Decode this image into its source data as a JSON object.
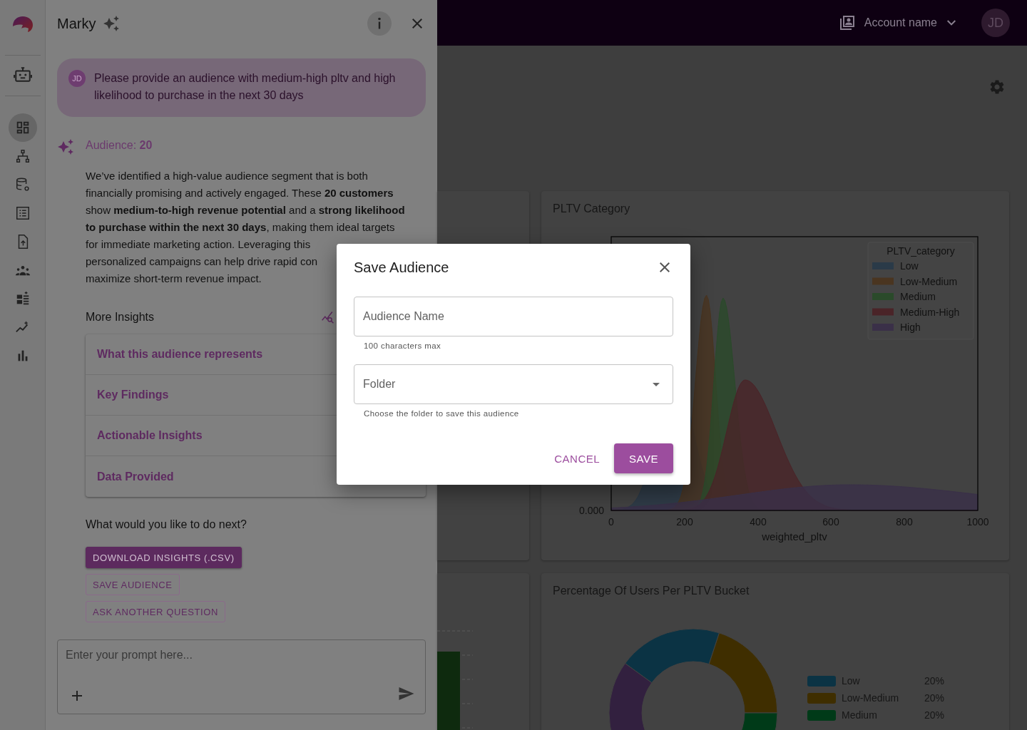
{
  "nav_rail": {
    "items": [
      {
        "selected": true
      },
      {
        "selected": false
      },
      {
        "selected": false
      },
      {
        "selected": false
      },
      {
        "selected": false
      },
      {
        "selected": false
      },
      {
        "selected": false
      },
      {
        "selected": false
      },
      {
        "selected": false
      }
    ]
  },
  "chat": {
    "title": "Marky",
    "user_message": {
      "avatar": "JD",
      "text": "Please provide an audience with medium-high pltv and high likelihood to purchase in the next 30 days"
    },
    "response": {
      "heading": "Audience: **20**",
      "body": [
        "We’ve identified a high-value audience segment that is both\nfinancially promising and actively engaged. These **20 customers**\nshow **medium-to-high revenue potential** and a **strong likelihood**\n**to purchase within the next 30 days**, making them ideal targets",
        "for immediate marketing action. Leveraging this\npersonalized campaigns can help drive rapid con\nmaximize short-term revenue impact."
      ],
      "insights_title": "More Insights",
      "insights": [
        "What this audience represents",
        "Key Findings",
        "Actionable Insights",
        "Data Provided"
      ],
      "next_prompt": "What would you like to do next?",
      "actions": [
        {
          "label": "DOWNLOAD INSIGHTS (.CSV)",
          "kind": "filled"
        },
        {
          "label": "SAVE AUDIENCE",
          "kind": "outlined"
        },
        {
          "label": "ASK ANOTHER QUESTION",
          "kind": "outlined"
        }
      ]
    },
    "prompt": {
      "placeholder": "Enter your prompt here..."
    }
  },
  "top_bar": {
    "account": "Account name",
    "avatar": "JD"
  },
  "pltv_chart": {
    "title": "PLTV Category",
    "legend_title": "PLTV_category",
    "legend": [
      {
        "label": "Low",
        "color": "#2a3a48"
      },
      {
        "label": "Low-Medium",
        "color": "#4a3520"
      },
      {
        "label": "Medium",
        "color": "#2a4a2a"
      },
      {
        "label": "Medium-High",
        "color": "#4a2428"
      },
      {
        "label": "High",
        "color": "#3a3048"
      }
    ],
    "x_tick_labels": [
      "0",
      "200",
      "400",
      "600",
      "800",
      "1000"
    ],
    "y_tick_label": "0.000",
    "x_label": "weighted_pltv"
  },
  "bucket_chart": {
    "title": "Percentage Of Users Per PLTV Bucket",
    "legend": [
      {
        "label": "Low",
        "value": "20%",
        "color": "#0b3344"
      },
      {
        "label": "Low-Medium",
        "value": "20%",
        "color": "#3f2e00"
      },
      {
        "label": "Medium",
        "value": "20%",
        "color": "#003a18"
      }
    ]
  },
  "dialog": {
    "title": "Save Audience",
    "fields": [
      {
        "kind": "text",
        "placeholder": "Audience Name",
        "helper": "100 characters max"
      },
      {
        "kind": "select",
        "placeholder": "Folder",
        "helper": "Choose the folder to save this audience"
      }
    ],
    "buttons": [
      {
        "label": "CANCEL",
        "kind": "text"
      },
      {
        "label": "SAVE",
        "kind": "filled"
      }
    ]
  }
}
